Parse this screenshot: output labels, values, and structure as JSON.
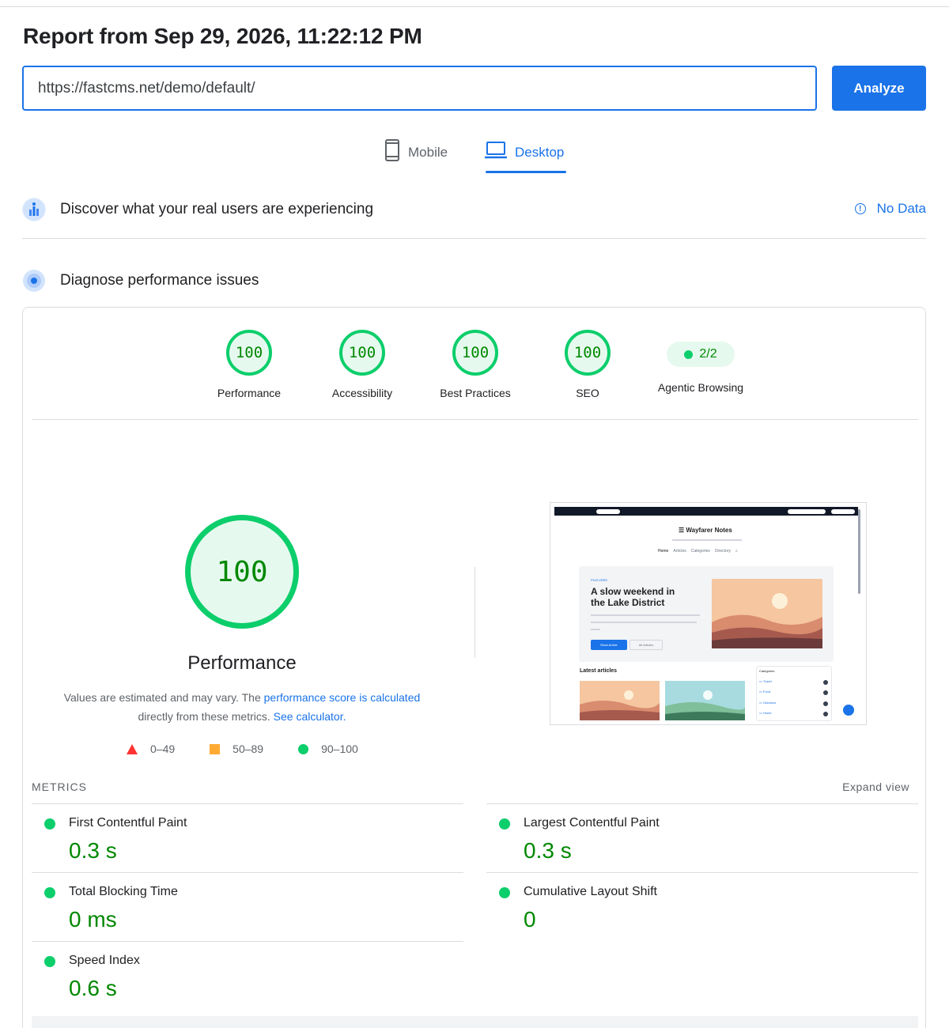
{
  "report": {
    "title": "Report from Sep 29, 2026, 11:22:12 PM",
    "url_value": "https://fastcms.net/demo/default/",
    "analyze_label": "Analyze"
  },
  "device_tabs": {
    "mobile_label": "Mobile",
    "desktop_label": "Desktop",
    "selected": "Desktop"
  },
  "field_data": {
    "title": "Discover what your real users are experiencing",
    "status": "No Data"
  },
  "diagnose": {
    "title": "Diagnose performance issues"
  },
  "categories": [
    {
      "label": "Performance",
      "score": "100"
    },
    {
      "label": "Accessibility",
      "score": "100"
    },
    {
      "label": "Best Practices",
      "score": "100"
    },
    {
      "label": "SEO",
      "score": "100"
    },
    {
      "label": "Agentic Browsing",
      "score": "2/2"
    }
  ],
  "performance": {
    "score": "100",
    "title": "Performance",
    "desc_prefix": "Values are estimated and may vary. The ",
    "desc_link1": "performance score is calculated",
    "desc_middle": " directly from these metrics. ",
    "desc_link2": "See calculator."
  },
  "legend": {
    "fail": "0–49",
    "average": "50–89",
    "pass": "90–100"
  },
  "screenshot": {
    "site_title": "Wayfarer Notes",
    "nav": [
      "Home",
      "Articles",
      "Categories",
      "Directory"
    ],
    "featured_label": "FEATURED",
    "featured_line1": "A slow weekend in",
    "featured_line2": "the Lake District",
    "read_button": "Read Article",
    "all_button": "All Articles",
    "latest_label": "Latest articles",
    "categories_label": "Categories",
    "categories": [
      "Travel",
      "Food",
      "Outdoors",
      "Home"
    ]
  },
  "metrics": {
    "section_label": "METRICS",
    "expand_label": "Expand view",
    "items": [
      {
        "name": "First Contentful Paint",
        "value": "0.3 s"
      },
      {
        "name": "Largest Contentful Paint",
        "value": "0.3 s"
      },
      {
        "name": "Total Blocking Time",
        "value": "0 ms"
      },
      {
        "name": "Cumulative Layout Shift",
        "value": "0"
      },
      {
        "name": "Speed Index",
        "value": "0.6 s"
      }
    ]
  },
  "colors": {
    "accent": "#1a73e8",
    "pass": "#0cce6b",
    "pass_text": "#008800",
    "average": "#ffaa33",
    "fail": "#ff3333"
  },
  "icons": {
    "mobile": "mobile-phone-icon",
    "desktop": "laptop-icon",
    "field": "users-chart-icon",
    "diagnose": "lighthouse-icon",
    "info": "info-icon"
  }
}
